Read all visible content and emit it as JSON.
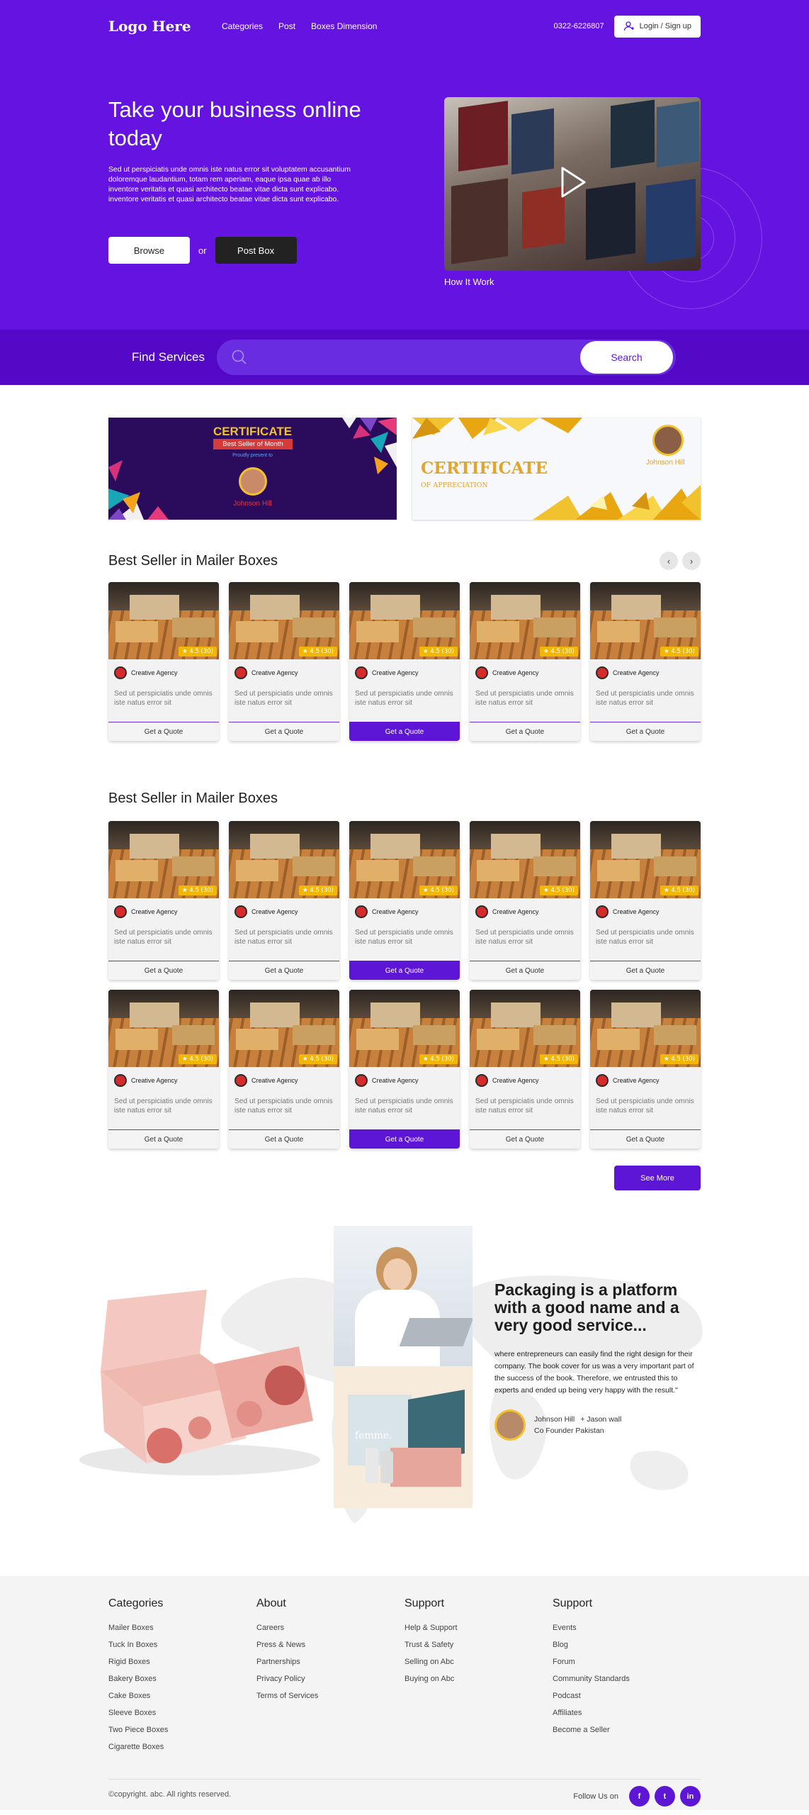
{
  "nav": {
    "logo": "Logo Here",
    "links": [
      "Categories",
      "Post",
      "Boxes Dimension"
    ],
    "phone": "0322-6226807",
    "login": "Login / Sign up"
  },
  "hero": {
    "title": "Take your business online today",
    "description": "Sed ut perspiciatis unde omnis iste natus error sit voluptatem accusantium doloremque laudantium, totam rem aperiam, eaque ipsa quae ab illo inventore veritatis et quasi architecto beatae vitae dicta sunt explicabo. inventore veritatis et quasi architecto beatae vitae dicta sunt explicabo.",
    "browse": "Browse",
    "or": "or",
    "post_box": "Post Box",
    "video_caption": "How It Work"
  },
  "find": {
    "label": "Find Services",
    "search_button": "Search"
  },
  "certificates": {
    "c1_title": "CERTIFICATE",
    "c1_banner": "Best Seller of Month",
    "c1_sub": "Proudly present to",
    "c1_name": "Johnson Hill",
    "c2_title": "CERTIFICATE",
    "c2_sub": "OF APPRECIATION",
    "c2_name": "Johnson Hill"
  },
  "section1": {
    "title": "Best Seller in Mailer Boxes",
    "cards": [
      {
        "rating": "4.5 (30)",
        "agency": "Creative Agency",
        "desc": "Sed ut perspiciatis unde omnis iste natus error sit",
        "button": "Get a Quote",
        "active": false
      },
      {
        "rating": "4.5 (30)",
        "agency": "Creative Agency",
        "desc": "Sed ut perspiciatis unde omnis iste natus error sit",
        "button": "Get a Quote",
        "active": false
      },
      {
        "rating": "4.5 (30)",
        "agency": "Creative Agency",
        "desc": "Sed ut perspiciatis unde omnis iste natus error sit",
        "button": "Get a Quote",
        "active": true
      },
      {
        "rating": "4.5 (30)",
        "agency": "Creative Agency",
        "desc": "Sed ut perspiciatis unde omnis iste natus error sit",
        "button": "Get a Quote",
        "active": false
      },
      {
        "rating": "4.5 (30)",
        "agency": "Creative Agency",
        "desc": "Sed ut perspiciatis unde omnis iste natus error sit",
        "button": "Get a Quote",
        "active": false
      }
    ]
  },
  "section2": {
    "title": "Best Seller in Mailer Boxes",
    "rows": [
      [
        {
          "rating": "4.5 (30)",
          "agency": "Creative Agency",
          "desc": "Sed ut perspiciatis unde omnis iste natus error sit",
          "button": "Get a Quote",
          "active": false
        },
        {
          "rating": "4.5 (30)",
          "agency": "Creative Agency",
          "desc": "Sed ut perspiciatis unde omnis iste natus error sit",
          "button": "Get a Quote",
          "active": false
        },
        {
          "rating": "4.5 (30)",
          "agency": "Creative Agency",
          "desc": "Sed ut perspiciatis unde omnis iste natus error sit",
          "button": "Get a Quote",
          "active": true
        },
        {
          "rating": "4.5 (30)",
          "agency": "Creative Agency",
          "desc": "Sed ut perspiciatis unde omnis iste natus error sit",
          "button": "Get a Quote",
          "active": false
        },
        {
          "rating": "4.5 (30)",
          "agency": "Creative Agency",
          "desc": "Sed ut perspiciatis unde omnis iste natus error sit",
          "button": "Get a Quote",
          "active": false
        }
      ],
      [
        {
          "rating": "4.5 (30)",
          "agency": "Creative Agency",
          "desc": "Sed ut perspiciatis unde omnis iste natus error sit",
          "button": "Get a Quote",
          "active": false
        },
        {
          "rating": "4.5 (30)",
          "agency": "Creative Agency",
          "desc": "Sed ut perspiciatis unde omnis iste natus error sit",
          "button": "Get a Quote",
          "active": false
        },
        {
          "rating": "4.5 (30)",
          "agency": "Creative Agency",
          "desc": "Sed ut perspiciatis unde omnis iste natus error sit",
          "button": "Get a Quote",
          "active": true
        },
        {
          "rating": "4.5 (30)",
          "agency": "Creative Agency",
          "desc": "Sed ut perspiciatis unde omnis iste natus error sit",
          "button": "Get a Quote",
          "active": false
        },
        {
          "rating": "4.5 (30)",
          "agency": "Creative Agency",
          "desc": "Sed ut perspiciatis unde omnis iste natus error sit",
          "button": "Get a Quote",
          "active": false
        }
      ]
    ],
    "see_more": "See More"
  },
  "testimonial": {
    "title": "Packaging is a platform with a good name and a very good service...",
    "quote": "where entrepreneurs can easily find the right design for their company. The book cover for us was a very important part of the success of the book. Therefore, we entrusted this to experts and ended up being very happy with the result.\"",
    "author": "Johnson Hill",
    "author2": "+ Jason wall",
    "role": "Co Founder Pakistan",
    "box_brand": "femme."
  },
  "footer": {
    "columns": [
      {
        "title": "Categories",
        "links": [
          "Mailer Boxes",
          "Tuck In Boxes",
          "Rigid Boxes",
          "Bakery Boxes",
          "Cake Boxes",
          "Sleeve Boxes",
          "Two Piece Boxes",
          "Cigarette Boxes"
        ]
      },
      {
        "title": "About",
        "links": [
          "Careers",
          "Press & News",
          "Partnerships",
          "Privacy Policy",
          "Terms of Services"
        ]
      },
      {
        "title": "Support",
        "links": [
          "Help & Support",
          "Trust & Safety",
          "Selling on Abc",
          "Buying on Abc"
        ]
      },
      {
        "title": "Support",
        "links": [
          "Events",
          "Blog",
          "Forum",
          "Community Standards",
          "Podcast",
          "Affiliates",
          "Become a Seller"
        ]
      }
    ],
    "copyright": "©copyright. abc. All rights reserved.",
    "follow": "Follow Us on",
    "socials": [
      {
        "icon": "facebook-icon",
        "glyph": "f"
      },
      {
        "icon": "twitter-icon",
        "glyph": "t"
      },
      {
        "icon": "linkedin-icon",
        "glyph": "in"
      }
    ]
  },
  "colors": {
    "primary": "#6413e0",
    "dark_purple": "#5409c7",
    "button_purple": "#5e16d6",
    "rating_yellow": "#f2b705"
  }
}
